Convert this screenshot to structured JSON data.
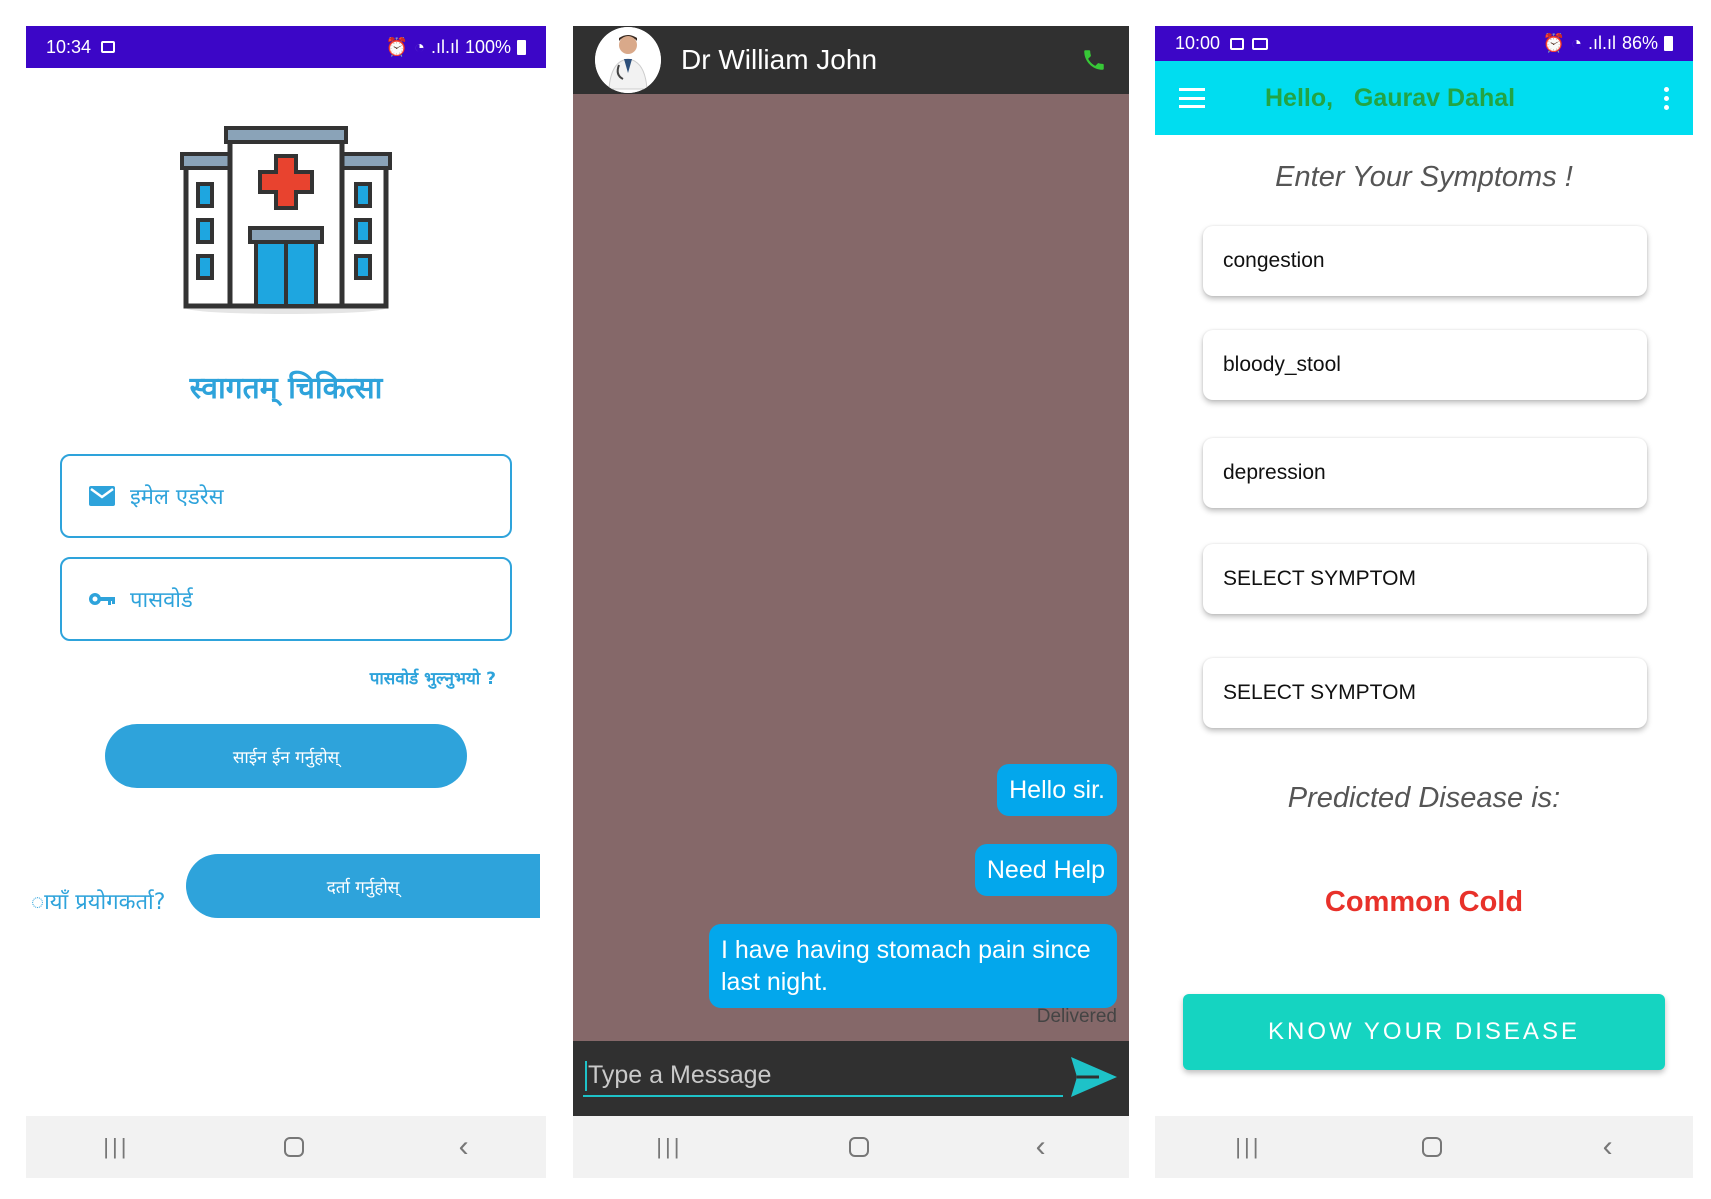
{
  "login_screen": {
    "status": {
      "time": "10:34",
      "battery": "100%"
    },
    "welcome_title": "स्वागतम् चिकित्सा",
    "email_placeholder": "इमेल एडरेस",
    "password_placeholder": "पासवोर्ड",
    "forgot_password": "पासवोर्ड भुल्नुभयो ?",
    "sign_in_label": "साईन ईन गर्नुहोस्",
    "new_user_label": "ायाँ प्रयोगकर्ता?",
    "register_label": "दर्ता गर्नुहोस्",
    "colors": {
      "accent": "#2ea3db",
      "status_bar": "#3c06c7"
    }
  },
  "chat_screen": {
    "contact_name": "Dr William John",
    "messages": [
      {
        "text": "Hello sir."
      },
      {
        "text": "Need Help"
      },
      {
        "text": "I have having stomach pain since last night."
      }
    ],
    "delivery_status": "Delivered",
    "input_placeholder": "Type a Message",
    "colors": {
      "background": "#856869",
      "bubble": "#03a7ec",
      "header": "#303030"
    }
  },
  "symptom_screen": {
    "status": {
      "time": "10:00",
      "battery": "86%"
    },
    "greeting": "Hello,   Gaurav Dahal",
    "heading": "Enter Your Symptoms !",
    "symptoms": [
      "congestion",
      "bloody_stool",
      "depression",
      "SELECT SYMPTOM",
      "SELECT SYMPTOM"
    ],
    "predicted_label": "Predicted Disease is:",
    "predicted_disease": "Common Cold",
    "know_button": "KNOW YOUR DISEASE",
    "colors": {
      "app_bar": "#00ddf0",
      "greeting": "#23a443",
      "disease": "#e8312a",
      "button": "#15d4c1"
    }
  },
  "nav_icons": [
    "recent-apps-icon",
    "home-icon",
    "back-icon"
  ]
}
